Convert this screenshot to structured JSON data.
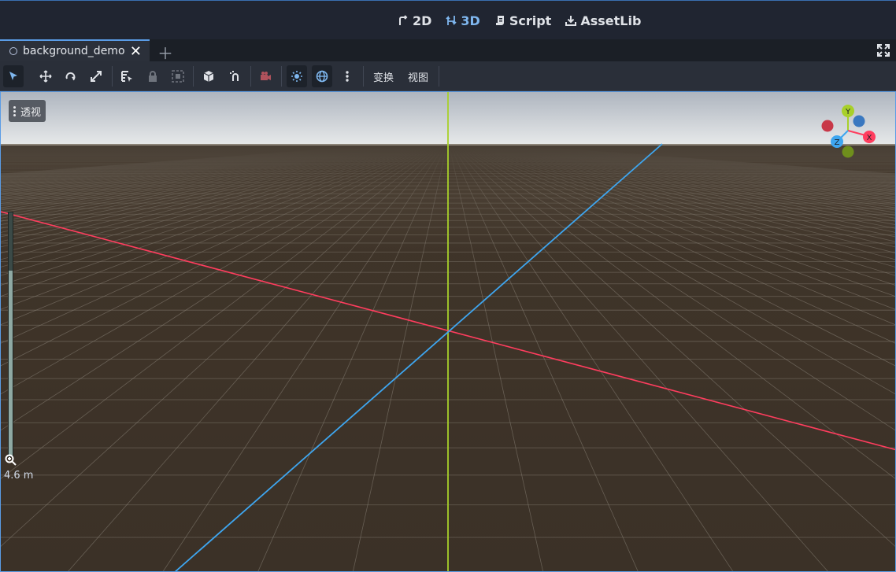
{
  "main_modes": [
    {
      "label": "2D",
      "icon": "2d-icon",
      "active": false
    },
    {
      "label": "3D",
      "icon": "3d-icon",
      "active": true
    },
    {
      "label": "Script",
      "icon": "script-icon",
      "active": false
    },
    {
      "label": "AssetLib",
      "icon": "assetlib-icon",
      "active": false
    }
  ],
  "scene_tabs": [
    {
      "label": "background_demo",
      "icon": "scene-circle-icon"
    }
  ],
  "toolbar": {
    "tools": [
      "select-tool-icon",
      "move-tool-icon",
      "rotate-tool-icon",
      "scale-tool-icon",
      "list-select-icon",
      "lock-icon",
      "group-icon",
      "local-space-icon",
      "snap-icon",
      "camera-preview-icon",
      "sun-preview-icon",
      "environment-preview-icon",
      "more-icon"
    ],
    "transform_menu": "变换",
    "view_menu": "视图"
  },
  "viewport": {
    "perspective_label": "透视",
    "zoom_readout": "4.6 m",
    "zoom_level_fraction": 0.76,
    "gizmo_axes": [
      "Y",
      "X",
      "Z"
    ]
  },
  "colors": {
    "accent": "#5a9ce6",
    "x_axis": "#ff3d5e",
    "y_axis": "#a8d02a",
    "z_axis": "#3ea6f0",
    "ground": "#3b3127"
  }
}
